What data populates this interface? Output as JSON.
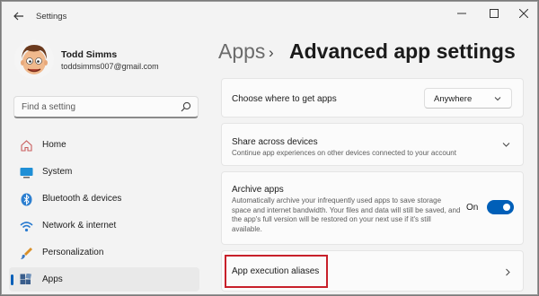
{
  "window": {
    "title": "Settings"
  },
  "user": {
    "name": "Todd Simms",
    "email": "toddsimms007@gmail.com"
  },
  "search": {
    "placeholder": "Find a setting"
  },
  "nav": {
    "items": [
      {
        "label": "Home",
        "icon": "home-icon"
      },
      {
        "label": "System",
        "icon": "system-icon"
      },
      {
        "label": "Bluetooth & devices",
        "icon": "bluetooth-icon"
      },
      {
        "label": "Network & internet",
        "icon": "wifi-icon"
      },
      {
        "label": "Personalization",
        "icon": "brush-icon"
      },
      {
        "label": "Apps",
        "icon": "apps-icon",
        "active": true
      }
    ]
  },
  "header": {
    "breadcrumb": "Apps",
    "separator": "›",
    "title": "Advanced app settings"
  },
  "settings": {
    "get_apps": {
      "title": "Choose where to get apps",
      "value": "Anywhere"
    },
    "share": {
      "title": "Share across devices",
      "description": "Continue app experiences on other devices connected to your account"
    },
    "archive": {
      "title": "Archive apps",
      "description": "Automatically archive your infrequently used apps to save storage space and internet bandwidth. Your files and data will still be saved, and the app's full version will be restored on your next use if it's still available.",
      "state": "On",
      "on": true
    },
    "aliases": {
      "title": "App execution aliases"
    }
  },
  "colors": {
    "accent": "#005fb8",
    "highlight": "#c8202a"
  }
}
